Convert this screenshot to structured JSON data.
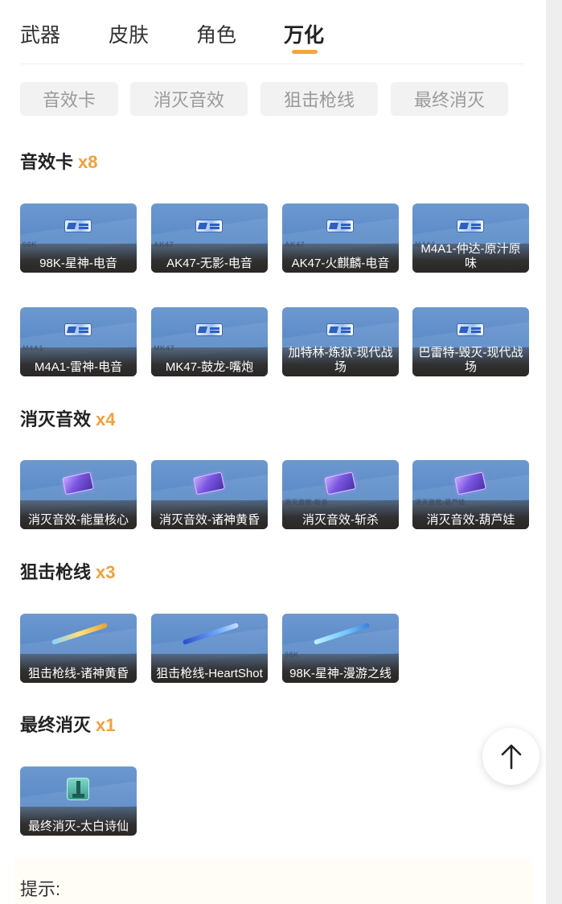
{
  "tabs": [
    {
      "label": "武器",
      "active": false
    },
    {
      "label": "皮肤",
      "active": false
    },
    {
      "label": "角色",
      "active": false
    },
    {
      "label": "万化",
      "active": true
    }
  ],
  "filters": [
    "音效卡",
    "消灭音效",
    "狙击枪线",
    "最终消灭"
  ],
  "sections": [
    {
      "title": "音效卡",
      "count": "x8",
      "items": [
        {
          "label": "98K-星神-电音",
          "tag": "98K",
          "icon": "soundcard-icon"
        },
        {
          "label": "AK47-无影-电音",
          "tag": "AK47",
          "icon": "soundcard-icon"
        },
        {
          "label": "AK47-火麒麟-电音",
          "tag": "AK47",
          "icon": "soundcard-icon"
        },
        {
          "label": "M4A1-仲达-原汁原味",
          "tag": "M4A1",
          "icon": "soundcard-icon"
        },
        {
          "label": "M4A1-雷神-电音",
          "tag": "M4A1",
          "icon": "soundcard-icon"
        },
        {
          "label": "MK47-鼓龙-嘴炮",
          "tag": "MK47",
          "icon": "soundcard-icon"
        },
        {
          "label": "加特林-炼狱-现代战场",
          "tag": "",
          "icon": "soundcard-icon"
        },
        {
          "label": "巴雷特-毁灭-现代战场",
          "tag": "",
          "icon": "soundcard-icon"
        }
      ]
    },
    {
      "title": "消灭音效",
      "count": "x4",
      "items": [
        {
          "label": "消灭音效-能量核心",
          "tag": "",
          "icon": "elimination-card-icon"
        },
        {
          "label": "消灭音效-诸神黄昏",
          "tag": "",
          "icon": "elimination-card-icon"
        },
        {
          "label": "消灭音效-斩杀",
          "tag": "消灭音效-斩杀",
          "icon": "elimination-card-icon"
        },
        {
          "label": "消灭音效-葫芦娃",
          "tag": "消灭音效-葫芦娃",
          "icon": "elimination-card-icon"
        }
      ]
    },
    {
      "title": "狙击枪线",
      "count": "x3",
      "items": [
        {
          "label": "狙击枪线-诸神黄昏",
          "tag": "",
          "icon": "sniper-line-icon"
        },
        {
          "label": "狙击枪线-HeartShot",
          "tag": "",
          "icon": "sniper-line-icon"
        },
        {
          "label": "98K-星神-漫游之线",
          "tag": "98K",
          "icon": "sniper-line-icon"
        }
      ]
    },
    {
      "title": "最终消灭",
      "count": "x1",
      "items": [
        {
          "label": "最终消灭-太白诗仙",
          "tag": "",
          "icon": "final-elimination-icon"
        }
      ]
    }
  ],
  "scroll_top": {
    "icon": "arrow-up-icon"
  },
  "hint": {
    "label": "提示:"
  },
  "colors": {
    "accent": "#f5a53a",
    "count": "#f0a040",
    "card_bg": "#5d8cc9"
  }
}
